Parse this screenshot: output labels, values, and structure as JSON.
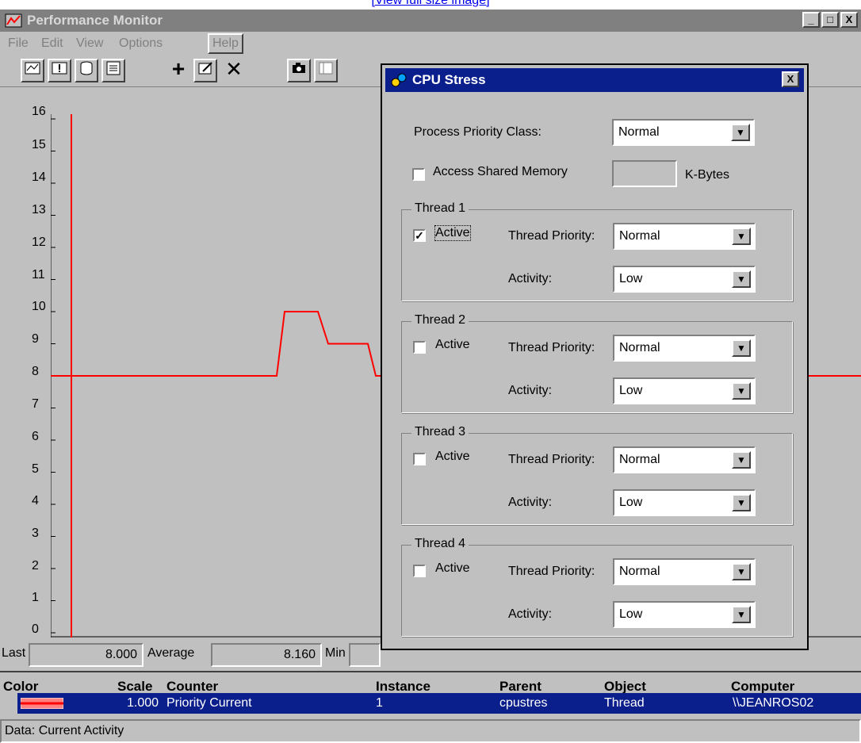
{
  "link": {
    "text": "[View full size image]"
  },
  "window": {
    "title": "Performance Monitor",
    "menu": [
      "File",
      "Edit",
      "View",
      "Options",
      "Help"
    ],
    "caption_buttons": [
      "_",
      "□",
      "X"
    ]
  },
  "toolbar": {
    "chart_view": "chart-icon",
    "alert_view": "alert-icon",
    "log_view": "log-icon",
    "report_view": "report-icon",
    "add": "+",
    "edit": "edit-icon",
    "delete": "✕",
    "snapshot": "camera-icon",
    "options": "options-icon"
  },
  "chart_data": {
    "type": "line",
    "ylim": [
      0,
      16
    ],
    "y_ticks": [
      "16",
      "15",
      "14",
      "13",
      "12",
      "11",
      "10",
      "9",
      "8",
      "7",
      "6",
      "5",
      "4",
      "3",
      "2",
      "1",
      "0"
    ],
    "series": [
      {
        "values": [
          8,
          8,
          8,
          10,
          10,
          9,
          9,
          8,
          8,
          8,
          8,
          8
        ]
      }
    ],
    "colors": {
      "series": "#ff0000",
      "plot_bg": "#c0c0c0"
    }
  },
  "stats": {
    "last_label": "Last",
    "last_value": "8.000",
    "average_label": "Average",
    "average_value": "8.160",
    "min_label": "Min"
  },
  "legend": {
    "headers": {
      "color": "Color",
      "scale": "Scale",
      "counter": "Counter",
      "instance": "Instance",
      "parent": "Parent",
      "object": "Object",
      "computer": "Computer"
    },
    "row": {
      "scale": "1.000",
      "counter": "Priority Current",
      "instance": "1",
      "parent": "cpustres",
      "object": "Thread",
      "computer": "\\\\JEANROS02"
    }
  },
  "status": {
    "text": "Data: Current Activity"
  },
  "dialog": {
    "title": "CPU Stress",
    "close": "X",
    "process_priority_label": "Process Priority Class:",
    "process_priority_value": "Normal",
    "shared_memory_label": "Access Shared Memory",
    "kbytes_label": "K-Bytes",
    "threads": [
      {
        "title": "Thread 1",
        "active_label": "Active",
        "active": true,
        "priority_label": "Thread Priority:",
        "priority": "Normal",
        "activity_label": "Activity:",
        "activity": "Low"
      },
      {
        "title": "Thread 2",
        "active_label": "Active",
        "active": false,
        "priority_label": "Thread Priority:",
        "priority": "Normal",
        "activity_label": "Activity:",
        "activity": "Low"
      },
      {
        "title": "Thread 3",
        "active_label": "Active",
        "active": false,
        "priority_label": "Thread Priority:",
        "priority": "Normal",
        "activity_label": "Activity:",
        "activity": "Low"
      },
      {
        "title": "Thread 4",
        "active_label": "Active",
        "active": false,
        "priority_label": "Thread Priority:",
        "priority": "Normal",
        "activity_label": "Activity:",
        "activity": "Low"
      }
    ]
  }
}
